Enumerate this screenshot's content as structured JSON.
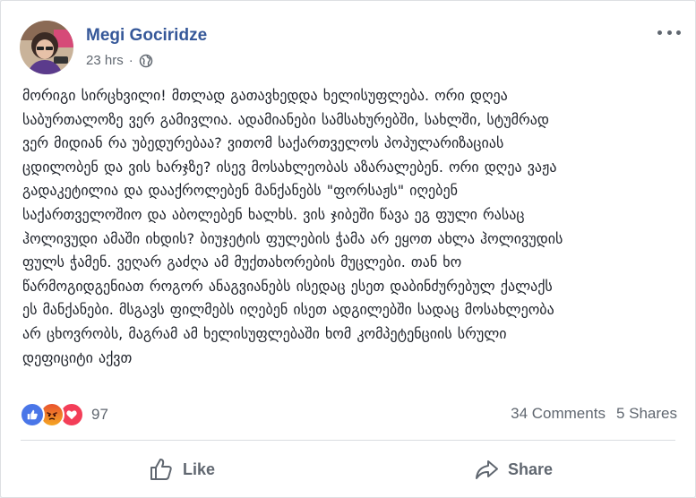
{
  "post": {
    "author": "Megi Gociridze",
    "timestamp": "23 hrs",
    "separator": "·",
    "audience_icon": "globe-icon",
    "menu_icon": "more-options-icon",
    "text_lines": [
      "მორიგი სირცხვილი! მთლად გათავხედდა ხელისუფლება. ორი დღეა",
      "საბურთალოზე ვერ გამივლია. ადამიანები სამსახურებში, სახლში, სტუმრად",
      "ვერ მიდიან რა უბედურებაა? ვითომ საქართველოს პოპულარიზაციას",
      "ცდილობენ და ვის ხარჯზე? ისევ მოსახლეობას აზარალებენ. ორი დღეა ვაჟა",
      "გადაკეტილია და დააქროლებენ მანქანებს \"ფორსაჟს\" იღებენ",
      "საქართველოშიო და აბოლებენ ხალხს. ვის ჯიბეში წავა ეგ ფული რასაც",
      "ჰოლივუდი ამაში იხდის? ბიუჯეტის ფულების ჭამა არ ეყოთ ახლა ჰოლივუდის",
      "ფულს ჭამენ. ვეღარ გაძღა ამ მუქთახორების მუცლები. თან ხო",
      "წარმოგიდგენიათ როგორ ანაგვიანებს ისედაც ესეთ დაბინძურებულ ქალაქს",
      "ეს მანქანები. მსგავს ფილმებს იღებენ ისეთ ადგილებში სადაც მოსახლეობა",
      "არ ცხოვრობს, მაგრამ ამ ხელისუფლებაში ხომ კომპეტენციის სრული",
      "დეფიციტი აქვთ"
    ]
  },
  "reactions": {
    "types": [
      "like",
      "angry",
      "love"
    ],
    "count": "97",
    "colors": {
      "like": "#4a76e8",
      "angry": "#f0782b",
      "love": "#f33e58"
    }
  },
  "stats": {
    "comments": "34 Comments",
    "shares": "5 Shares"
  },
  "actions": {
    "like_label": "Like",
    "share_label": "Share"
  },
  "colors": {
    "author": "#365899",
    "meta": "#606770",
    "text": "#1d2129"
  }
}
